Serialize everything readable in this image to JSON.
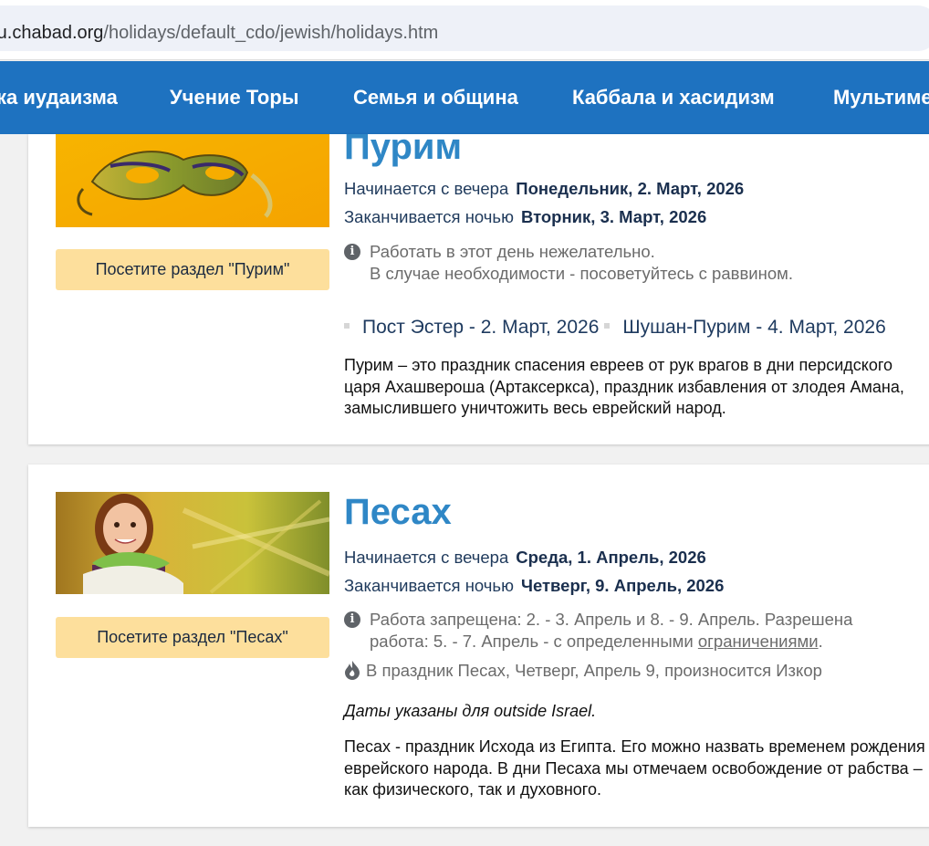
{
  "browser": {
    "url_host": "ru.chabad.org",
    "url_path": "/holidays/default_cdo/jewish/holidays.htm"
  },
  "nav": {
    "items": [
      {
        "label": "ка иудаизма"
      },
      {
        "label": "Учение Торы"
      },
      {
        "label": "Семья и община"
      },
      {
        "label": "Каббала и хасидизм"
      },
      {
        "label": "Мультиме"
      }
    ]
  },
  "holidays": [
    {
      "title": "Пурим",
      "starts_label": "Начинается с вечера",
      "starts_date": "Понедельник, 2. Март, 2026",
      "ends_label": "Заканчивается ночью",
      "ends_date": "Вторник, 3. Март, 2026",
      "info_line1": "Работать в этот день нежелательно.",
      "info_line2": "В случае необходимости - посоветуйтесь с раввином.",
      "related": [
        "Пост Эстер - 2. Март, 2026",
        "Шушан-Пурим - 4. Март, 2026"
      ],
      "description": "Пурим – это праздник спасения евреев от рук врагов в дни персидского царя Ахашвероша (Артаксеркса), праздник избавления от злодея Амана, замыслившего уничтожить весь еврейский народ.",
      "button": "Посетите раздел \"Пурим\"",
      "icon": "info-icon"
    },
    {
      "title": "Песах",
      "starts_label": "Начинается с вечера",
      "starts_date": "Среда, 1. Апрель, 2026",
      "ends_label": "Заканчивается ночью",
      "ends_date": "Четверг, 9. Апрель, 2026",
      "info_line1": "Работа запрещена: 2. - 3. Апрель и 8. - 9. Апрель. Разрешена",
      "info_line2_prefix": "работа: 5. - 7. Апрель - с определенными ",
      "info_line2_link": "ограничениями",
      "info_line2_suffix": ".",
      "yizkor": "В праздник Песах, Четверг, Апрель 9, произносится Изкор",
      "note": "Даты указаны для outside Israel.",
      "description": "Песах - праздник Исхода из Египта. Его можно назвать временем рождения еврейского народа. В дни Песаха мы отмечаем освобождение от рабства – как физического, так и духовного.",
      "button": "Посетите раздел \"Песах\"",
      "icon": "info-icon",
      "yizkor_icon": "candle-flame-icon"
    }
  ],
  "info_icon_glyph": "i",
  "colors": {
    "nav": "#1e72c0",
    "title": "#2f87c6",
    "button": "#fddf9c"
  }
}
